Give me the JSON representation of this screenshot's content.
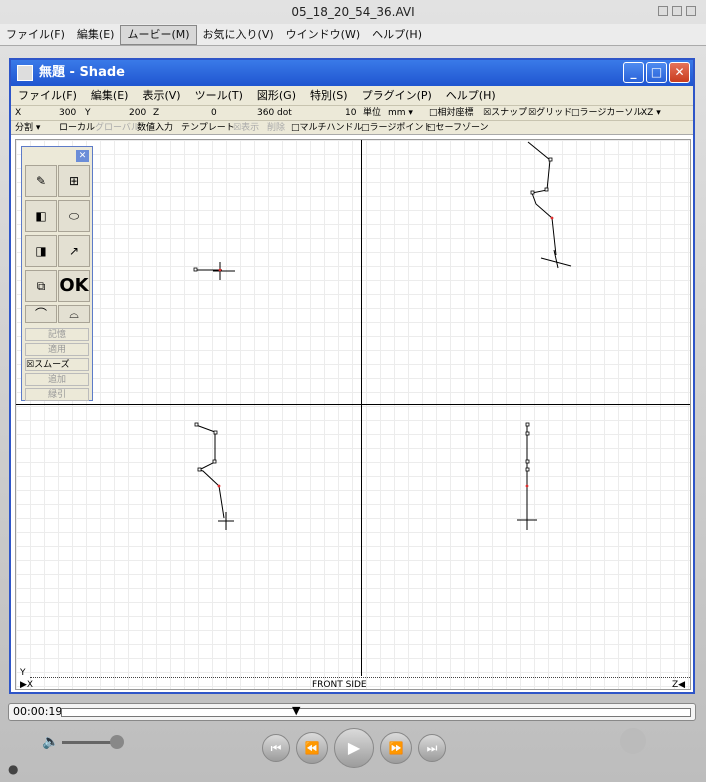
{
  "qt_window": {
    "title": "05_18_20_54_36.AVI"
  },
  "qt_menu": [
    "ファイル(F)",
    "編集(E)",
    "ムービー(M)",
    "お気に入り(V)",
    "ウインドウ(W)",
    "ヘルプ(H)"
  ],
  "shade": {
    "title": "無題 - Shade",
    "menu": [
      "ファイル(F)",
      "編集(E)",
      "表示(V)",
      "ツール(T)",
      "図形(G)",
      "特別(S)",
      "プラグイン(P)",
      "ヘルプ(H)"
    ],
    "coords": {
      "x_label": "X",
      "x_value": "300",
      "y_label": "Y",
      "y_value": "200",
      "z_label": "Z",
      "z_value": "0",
      "dot_value": "360 dot",
      "ten": "10",
      "unit_label": "単位",
      "unit_value": "mm ▾",
      "rel": "□相対座標",
      "snap": "☒スナップ",
      "grid": "☒グリッド",
      "large_cursor": "□ラージカーソル",
      "plane": "XZ ▾"
    },
    "options": {
      "split": "分割 ▾",
      "local": "ローカル",
      "global": "グローバル",
      "numeric": "数値入力",
      "template": "テンプレート",
      "display": "☒表示",
      "delete": "削除",
      "multi_handle": "□マルチハンドル",
      "large_point": "□ラージポイント",
      "safe_zone": "□セーフゾーン"
    },
    "tools": {
      "ok": "OK",
      "memory": "記憶",
      "apply": "適用",
      "smooth": "☒スムーズ",
      "add": "追加",
      "minus": "緑引"
    },
    "view": {
      "label": "FRONT SIDE",
      "x_axis": "▶X",
      "z_axis": "Z◀",
      "y_axis": "Y"
    }
  },
  "player": {
    "time": "00:00:19",
    "playhead": "▼"
  }
}
